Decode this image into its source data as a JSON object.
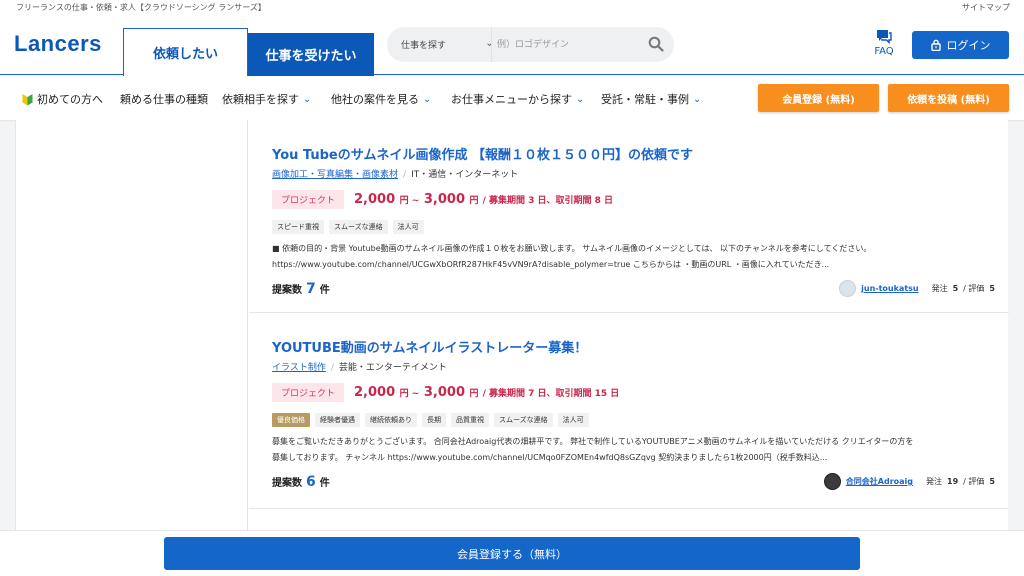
{
  "topbar": {
    "tagline": "フリーランスの仕事・依頼・求人【クラウドソーシング ランサーズ】",
    "sitemap": "サイトマップ"
  },
  "header": {
    "logo": "Lancers",
    "tab_request": "依頼したい",
    "tab_work": "仕事を受けたい",
    "search_scope": "仕事を探す",
    "search_placeholder": "例）ロゴデザイン",
    "faq": "FAQ",
    "login": "ログイン"
  },
  "nav": {
    "items": [
      {
        "label": "初めての方へ"
      },
      {
        "label": "頼める仕事の種類"
      },
      {
        "label": "依頼相手を探す"
      },
      {
        "label": "他社の案件を見る"
      },
      {
        "label": "お仕事メニューから探す"
      },
      {
        "label": "受託・常駐・事例"
      }
    ],
    "member_register": "会員登録 (無料)",
    "post_request": "依頼を投稿 (無料)"
  },
  "jobs": [
    {
      "title": "You Tubeのサムネイル画像作成 【報酬１０枚１５００円】の依頼です",
      "category_link": "画像加工・写真編集・画像素材",
      "category_industry": "IT・通信・インターネット",
      "badge": "プロジェクト",
      "price_min": "2,000",
      "price_max": "3,000",
      "yen_sep": "円 ~",
      "yen": "円",
      "period": "/ 募集期間 3 日、取引期間 8 日",
      "tags": [
        "スピード重視",
        "スムーズな連絡",
        "法人可"
      ],
      "desc_line1": "■ 依頼の目的・背景 Youtube動画のサムネイル画像の作成１０枚をお願い致します。 サムネイル画像のイメージとしては、 以下のチャンネルを参考にしてください。",
      "desc_line2": "https://www.youtube.com/channel/UCGwXbORfR287HkF45vVN9rA?disable_polymer=true こちらからは ・動画のURL ・画像に入れていただき...",
      "proposals_label": "提案数",
      "proposals": "7",
      "proposals_unit": "件",
      "client_name": "jun-toukatsu",
      "orders_label": "発注",
      "orders": "5",
      "rating_label": "/ 評価",
      "rating": "5"
    },
    {
      "title": "YOUTUBE動画のサムネイルイラストレーター募集！",
      "category_link": "イラスト制作",
      "category_industry": "芸能・エンターテイメント",
      "badge": "プロジェクト",
      "price_min": "2,000",
      "price_max": "3,000",
      "yen_sep": "円 ~",
      "yen": "円",
      "period": "/ 募集期間 7 日、取引期間 15 日",
      "gold_tag": "優良価格",
      "tags": [
        "経験者優遇",
        "継続依頼あり",
        "長期",
        "品質重視",
        "スムーズな連絡",
        "法人可"
      ],
      "desc_line1": "募集をご覧いただきありがとうございます。 合同会社Adroaig代表の畑耕平です。 弊社で制作しているYOUTUBEアニメ動画のサムネイルを描いていただける クリエイターの方を",
      "desc_line2": "募集しております。 チャンネル https://www.youtube.com/channel/UCMqo0FZOMEn4wfdQ8sGZqvg 契約決まりましたら1枚2000円（税手数料込...",
      "proposals_label": "提案数",
      "proposals": "6",
      "proposals_unit": "件",
      "client_name": "合同会社Adroaig",
      "orders_label": "発注",
      "orders": "19",
      "rating_label": "/ 評価",
      "rating": "5"
    }
  ],
  "bottom": {
    "register": "会員登録する（無料）"
  },
  "colors": {
    "brand_blue": "#1566c9",
    "orange": "#f78e1e",
    "price_red": "#c8274d"
  }
}
